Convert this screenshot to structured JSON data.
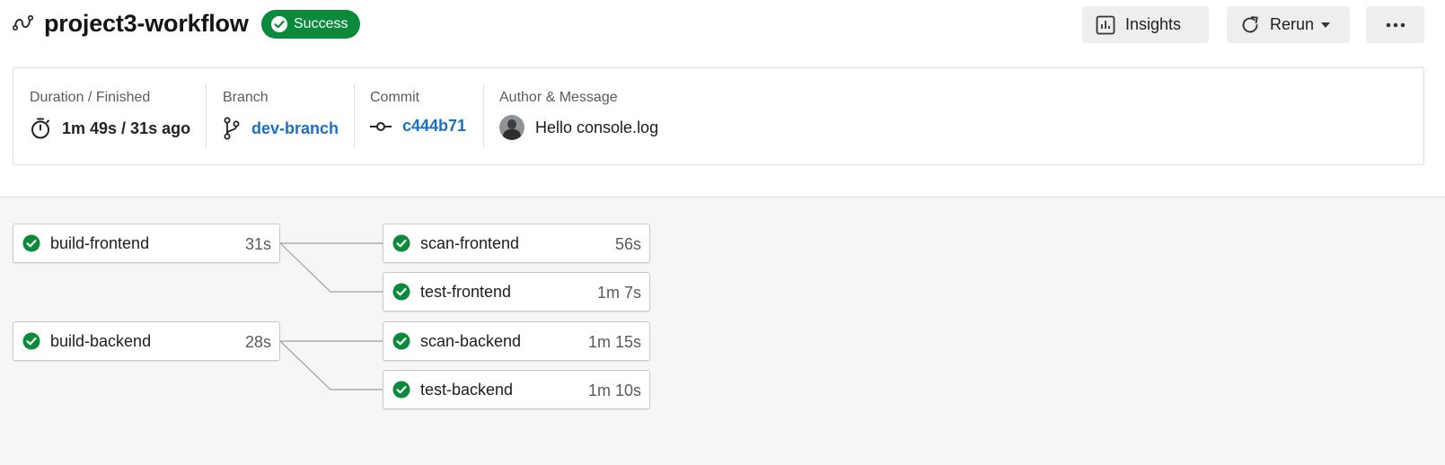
{
  "header": {
    "title": "project3-workflow",
    "status": "Success",
    "status_color": "#0a8a3a",
    "workflow_icon": "workflow-icon",
    "buttons": {
      "insights_label": "Insights",
      "insights_icon": "bar-chart-icon",
      "rerun_label": "Rerun",
      "rerun_icon": "refresh-icon",
      "more_icon": "ellipsis-icon"
    }
  },
  "summary": {
    "duration": {
      "caption": "Duration / Finished",
      "value": "1m 49s / 31s ago",
      "icon": "stopwatch-icon"
    },
    "branch": {
      "caption": "Branch",
      "value": "dev-branch",
      "icon": "git-branch-icon"
    },
    "commit": {
      "caption": "Commit",
      "value": "c444b71",
      "icon": "git-commit-icon"
    },
    "author": {
      "caption": "Author & Message",
      "message": "Hello console.log",
      "icon": "avatar"
    }
  },
  "jobs": [
    {
      "name": "build-frontend",
      "duration": "31s",
      "status": "success"
    },
    {
      "name": "build-backend",
      "duration": "28s",
      "status": "success"
    },
    {
      "name": "scan-frontend",
      "duration": "56s",
      "status": "success"
    },
    {
      "name": "test-frontend",
      "duration": "1m 7s",
      "status": "success"
    },
    {
      "name": "scan-backend",
      "duration": "1m 15s",
      "status": "success"
    },
    {
      "name": "test-backend",
      "duration": "1m 10s",
      "status": "success"
    }
  ],
  "colors": {
    "success": "#0a8a3a",
    "link": "#1a6fc2",
    "canvas_bg": "#f6f6f6"
  }
}
